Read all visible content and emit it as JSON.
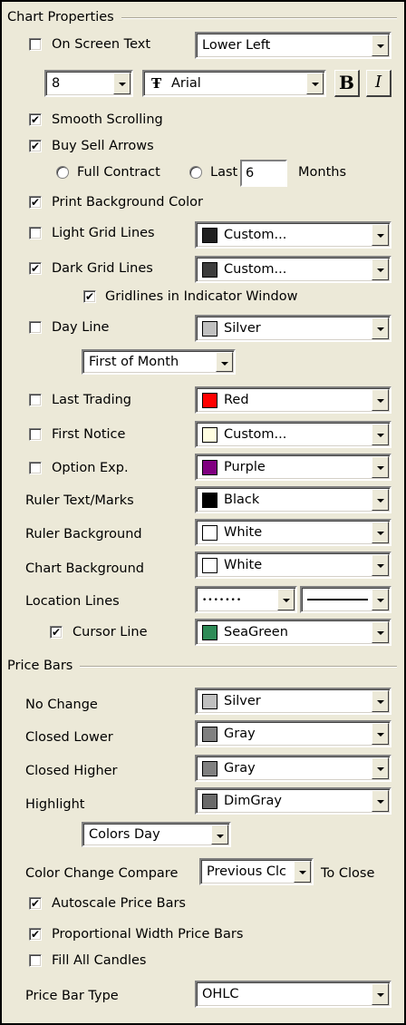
{
  "chart_properties": {
    "title": "Chart Properties",
    "on_screen_text": {
      "label": "On Screen Text",
      "checked": false,
      "value": "Lower Left"
    },
    "font_size": "8",
    "font_name": "Arial",
    "bold_label": "B",
    "italic_label": "I",
    "smooth_scrolling": {
      "label": "Smooth Scrolling",
      "checked": true
    },
    "buy_sell_arrows": {
      "label": "Buy Sell Arrows",
      "checked": true
    },
    "full_contract_label": "Full Contract",
    "last_label": "Last",
    "last_value": "6",
    "months_label": "Months",
    "print_background": {
      "label": "Print Background Color",
      "checked": true
    },
    "light_grid": {
      "label": "Light Grid Lines",
      "checked": false,
      "value": "Custom...",
      "color": "#1f1f1f"
    },
    "dark_grid": {
      "label": "Dark Grid Lines",
      "checked": true,
      "value": "Custom...",
      "color": "#3c3c3c"
    },
    "gridlines_indicator": {
      "label": "Gridlines in Indicator Window",
      "checked": true
    },
    "day_line": {
      "label": "Day Line",
      "checked": false,
      "value": "Silver",
      "color": "#c0c0c0"
    },
    "day_line_period": "First of Month",
    "last_trading": {
      "label": "Last Trading",
      "checked": false,
      "value": "Red",
      "color": "#ff0000"
    },
    "first_notice": {
      "label": "First Notice",
      "checked": false,
      "value": "Custom...",
      "color": "#fffde0"
    },
    "option_exp": {
      "label": "Option Exp.",
      "checked": false,
      "value": "Purple",
      "color": "#800080"
    },
    "ruler_text": {
      "label": "Ruler Text/Marks",
      "value": "Black",
      "color": "#000000"
    },
    "ruler_background": {
      "label": "Ruler Background",
      "value": "White",
      "color": "#ffffff"
    },
    "chart_background": {
      "label": "Chart Background",
      "value": "White",
      "color": "#ffffff"
    },
    "location_lines_label": "Location Lines",
    "location_lines_dotted": "•••••••",
    "cursor_line": {
      "label": "Cursor Line",
      "checked": true,
      "value": "SeaGreen",
      "color": "#2e8b57"
    }
  },
  "price_bars": {
    "title": "Price Bars",
    "no_change": {
      "label": "No Change",
      "value": "Silver",
      "color": "#c0c0c0"
    },
    "closed_lower": {
      "label": "Closed Lower",
      "value": "Gray",
      "color": "#808080"
    },
    "closed_higher": {
      "label": "Closed Higher",
      "value": "Gray",
      "color": "#808080"
    },
    "highlight": {
      "label": "Highlight",
      "value": "DimGray",
      "color": "#696969"
    },
    "colors_period": "Colors Day",
    "compare_label": "Color Change Compare",
    "compare_value": "Previous Clc",
    "to_close_label": "To Close",
    "autoscale": {
      "label": "Autoscale Price Bars",
      "checked": true
    },
    "proportional": {
      "label": "Proportional Width Price Bars",
      "checked": true
    },
    "fill_candles": {
      "label": "Fill All Candles",
      "checked": false
    },
    "bar_type_label": "Price Bar Type",
    "bar_type_value": "OHLC"
  }
}
